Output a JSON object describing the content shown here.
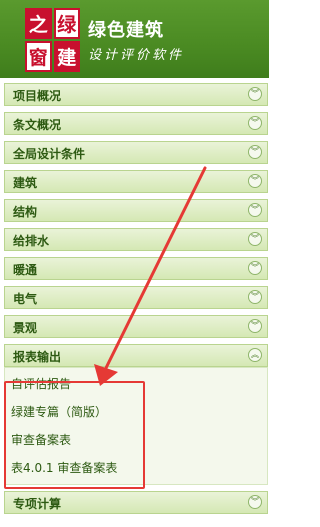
{
  "header": {
    "logo_chars": [
      "之",
      "绿",
      "窗",
      "建"
    ],
    "title": "绿色建筑",
    "subtitle": "设计评价软件"
  },
  "menu": [
    {
      "label": "项目概况",
      "expanded": false
    },
    {
      "label": "条文概况",
      "expanded": false
    },
    {
      "label": "全局设计条件",
      "expanded": false
    },
    {
      "label": "建筑",
      "expanded": false
    },
    {
      "label": "结构",
      "expanded": false
    },
    {
      "label": "给排水",
      "expanded": false
    },
    {
      "label": "暖通",
      "expanded": false
    },
    {
      "label": "电气",
      "expanded": false
    },
    {
      "label": "景观",
      "expanded": false
    },
    {
      "label": "报表输出",
      "expanded": true,
      "children": [
        "自评估报告",
        "绿建专篇（简版）",
        "审查备案表",
        "表4.0.1 审查备案表"
      ]
    },
    {
      "label": "专项计算",
      "expanded": false
    }
  ],
  "icons": {
    "collapsed": "chevron-down-icon",
    "expanded": "chevron-up-icon"
  },
  "colors": {
    "header_green": "#4a8a22",
    "logo_red": "#c8102e",
    "annotation_red": "#e53935"
  }
}
